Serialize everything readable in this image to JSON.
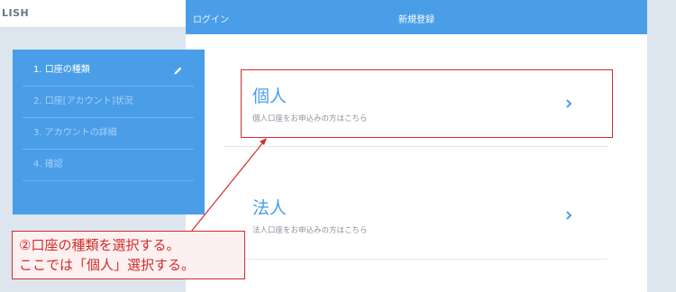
{
  "topbar": {
    "language_label": "LISH"
  },
  "header": {
    "login_label": "ログイン",
    "title": "新規登録"
  },
  "sidebar": {
    "steps": [
      {
        "label": "1. 口座の種類"
      },
      {
        "label": "2. 口座[アカウント]状況"
      },
      {
        "label": "3. アカウントの詳細"
      },
      {
        "label": "4. 確認"
      }
    ]
  },
  "options": [
    {
      "title": "個人",
      "description": "個人口座をお申込みの方はこちら"
    },
    {
      "title": "法人",
      "description": "法人口座をお申込みの方はこちら"
    }
  ],
  "annotation": {
    "line1": "②口座の種類を選択する。",
    "line2": "ここでは「個人」選択する。"
  },
  "colors": {
    "accent": "#4a9ee8",
    "annotation": "#d22b2b"
  }
}
